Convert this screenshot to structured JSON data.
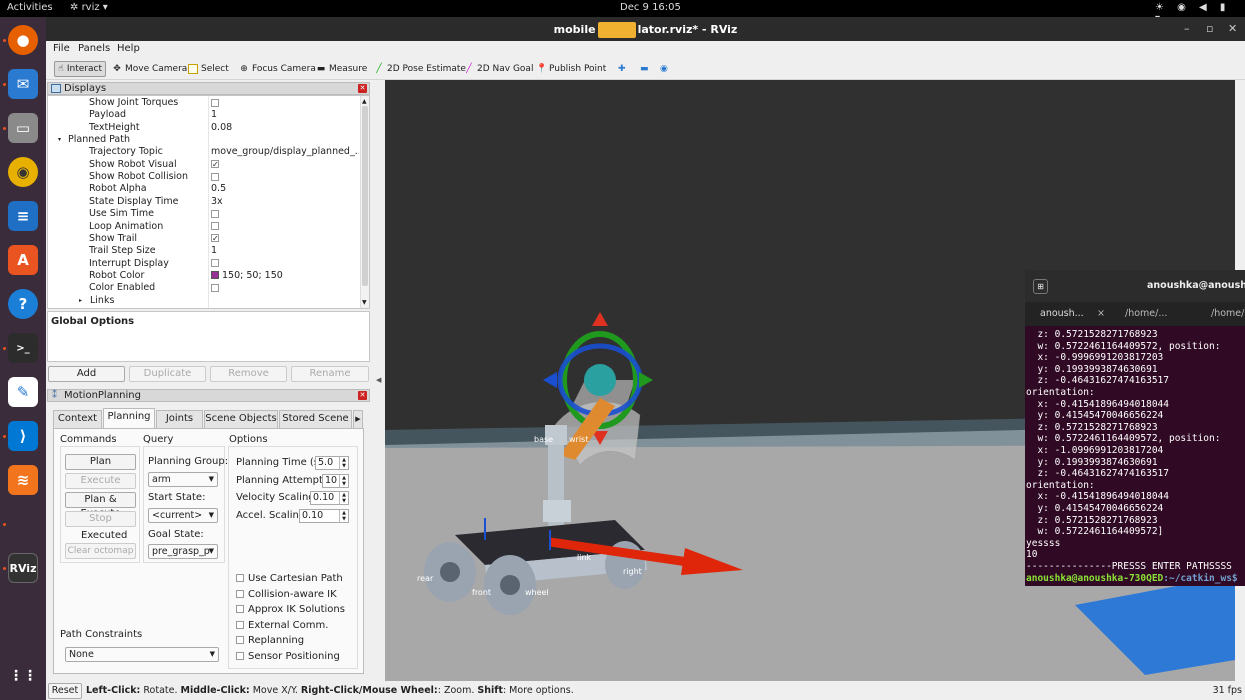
{
  "topbar": {
    "activities": "Activities",
    "app": "rviz",
    "clock": "Dec 9  16:05"
  },
  "window": {
    "title": "mobile_manipulator.rviz* - RViz",
    "title_left": "mobile",
    "title_right": "lator.rviz* - RViz"
  },
  "menu": [
    "File",
    "Panels",
    "Help"
  ],
  "toolbar": {
    "interact": "Interact",
    "move_camera": "Move Camera",
    "select": "Select",
    "focus_camera": "Focus Camera",
    "measure": "Measure",
    "pose_estimate": "2D Pose Estimate",
    "nav_goal": "2D Nav Goal",
    "publish_point": "Publish Point"
  },
  "displays": {
    "title": "Displays",
    "rows": [
      {
        "k": "Show Joint Torques",
        "v": "",
        "cb": "off"
      },
      {
        "k": "Payload",
        "v": "1"
      },
      {
        "k": "TextHeight",
        "v": "0.08"
      },
      {
        "k": "Planned Path",
        "v": "",
        "group": true
      },
      {
        "k": "Trajectory Topic",
        "v": "move_group/display_planned_..."
      },
      {
        "k": "Show Robot Visual",
        "v": "",
        "cb": "on"
      },
      {
        "k": "Show Robot Collision",
        "v": "",
        "cb": "off"
      },
      {
        "k": "Robot Alpha",
        "v": "0.5"
      },
      {
        "k": "State Display Time",
        "v": "3x"
      },
      {
        "k": "Use Sim Time",
        "v": "",
        "cb": "off"
      },
      {
        "k": "Loop Animation",
        "v": "",
        "cb": "off"
      },
      {
        "k": "Show Trail",
        "v": "",
        "cb": "on"
      },
      {
        "k": "Trail Step Size",
        "v": "1"
      },
      {
        "k": "Interrupt Display",
        "v": "",
        "cb": "off"
      },
      {
        "k": "Robot Color",
        "v": "150; 50; 150",
        "swatch": "#963296"
      },
      {
        "k": "Color Enabled",
        "v": "",
        "cb": "off"
      },
      {
        "k": "Links",
        "v": "",
        "sub": true
      }
    ]
  },
  "global_options": "Global Options",
  "display_buttons": {
    "add": "Add",
    "duplicate": "Duplicate",
    "remove": "Remove",
    "rename": "Rename"
  },
  "motion": {
    "title": "MotionPlanning",
    "tabs": [
      "Context",
      "Planning",
      "Joints",
      "Scene Objects",
      "Stored Scene"
    ],
    "commands": "Commands",
    "query": "Query",
    "options": "Options",
    "plan": "Plan",
    "execute": "Execute",
    "plan_execute": "Plan & Execute",
    "stop": "Stop",
    "executed": "Executed",
    "clear_octomap": "Clear octomap",
    "planning_group_label": "Planning Group:",
    "planning_group": "arm",
    "start_state_label": "Start State:",
    "start_state": "<current>",
    "goal_state_label": "Goal State:",
    "goal_state": "pre_grasp_p",
    "planning_time_label": "Planning Time (s):",
    "planning_time": "5.0",
    "planning_attempts_label": "Planning Attempts:",
    "planning_attempts": "10",
    "velocity_label": "Velocity Scaling:",
    "velocity": "0.10",
    "accel_label": "Accel. Scaling:",
    "accel": "0.10",
    "checks": [
      "Use Cartesian Path",
      "Collision-aware IK",
      "Approx IK Solutions",
      "External Comm.",
      "Replanning",
      "Sensor Positioning"
    ],
    "path_constraints": "Path Constraints",
    "path_constraints_value": "None"
  },
  "terminal": {
    "title": "anoushka@anoushka-",
    "tabs": [
      "anoush...",
      "/home/...",
      "/home/"
    ],
    "lines": [
      "  z: 0.5721528271768923",
      "  w: 0.5722461164409572, position:",
      "  x: -0.9996991203817203",
      "  y: 0.1993993874630691",
      "  z: -0.46431627474163517",
      "orientation:",
      "  x: -0.41541896494018044",
      "  y: 0.41545470046656224",
      "  z: 0.5721528271768923",
      "  w: 0.5722461164409572, position:",
      "  x: -1.0996991203817204",
      "  y: 0.1993993874630691",
      "  z: -0.46431627474163517",
      "orientation:",
      "  x: -0.41541896494018044",
      "  y: 0.41545470046656224",
      "  z: 0.5721528271768923",
      "  w: 0.5722461164409572]",
      "yessss",
      "10",
      "---------------PRESSS ENTER PATHSSSS"
    ],
    "prompt_user": "anoushka@anoushka-730QED",
    "prompt_path": ":~/catkin_ws$"
  },
  "scene_labels": {
    "rear": "rear",
    "front": "front",
    "wheel": "wheel",
    "base": "base",
    "wrist": "wrist",
    "link": "link",
    "right": "right"
  },
  "status": {
    "reset": "Reset",
    "hint_1": "Left-Click:",
    "hint_1b": " Rotate. ",
    "hint_2": "Middle-Click:",
    "hint_2b": " Move X/Y. ",
    "hint_3": "Right-Click/Mouse Wheel:",
    "hint_3b": ": Zoom. ",
    "hint_4": "Shift",
    "hint_4b": ": More options.",
    "fps": "31 fps"
  },
  "colors": {
    "accent": "#e95420",
    "robot": "#963296",
    "terminal_bg": "#300a24",
    "prompt": "#8ae234",
    "path": "#729fcf"
  }
}
